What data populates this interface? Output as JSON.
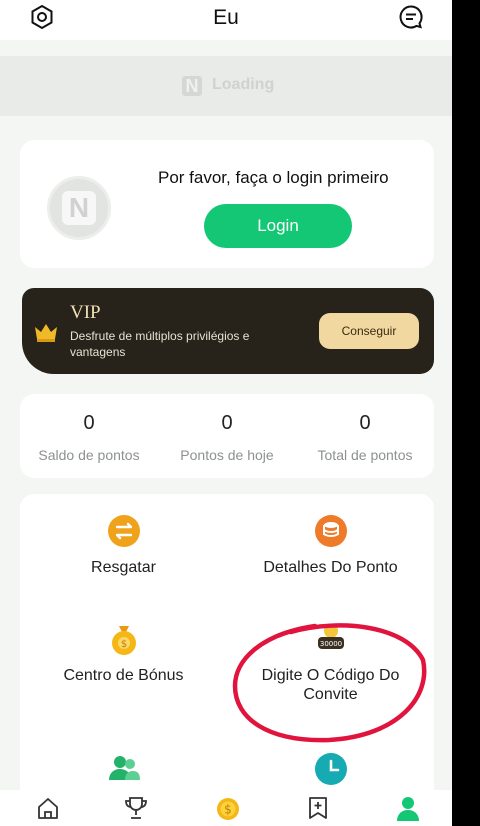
{
  "header": {
    "title": "Eu",
    "settings_icon": "gear-icon",
    "message_icon": "chat-icon"
  },
  "banner": {
    "logo_text": "N",
    "text": "Loading"
  },
  "login_card": {
    "avatar_text": "N",
    "prompt": "Por favor, faça o login primeiro",
    "button_label": "Login"
  },
  "vip": {
    "title": "VIP",
    "description": "Desfrute de múltiplos privilégios e vantagens",
    "button_label": "Conseguir",
    "icon": "crown-icon"
  },
  "stats": [
    {
      "value": "0",
      "label": "Saldo de pontos"
    },
    {
      "value": "0",
      "label": "Pontos de hoje"
    },
    {
      "value": "0",
      "label": "Total de pontos"
    }
  ],
  "menu": [
    {
      "label": "Resgatar",
      "icon": "exchange-icon"
    },
    {
      "label": "Detalhes Do Ponto",
      "icon": "coins-stack-icon"
    },
    {
      "label": "Centro de Bónus",
      "icon": "money-bag-icon"
    },
    {
      "label": "Digite O Código Do Convite",
      "icon": "treasure-icon",
      "badge": "30000"
    },
    {
      "label": "",
      "icon": "users-icon"
    },
    {
      "label": "",
      "icon": "clock-icon"
    }
  ],
  "bottom_nav": [
    {
      "icon": "home-icon"
    },
    {
      "icon": "trophy-icon"
    },
    {
      "icon": "coin-icon"
    },
    {
      "icon": "bookmark-icon"
    },
    {
      "icon": "profile-icon",
      "active": true
    }
  ],
  "colors": {
    "primary_green": "#13c774",
    "vip_bg": "#27221a",
    "vip_button": "#f1d7a0",
    "icon_orange": "#f0a21b",
    "annotation_red": "#e0143c"
  }
}
